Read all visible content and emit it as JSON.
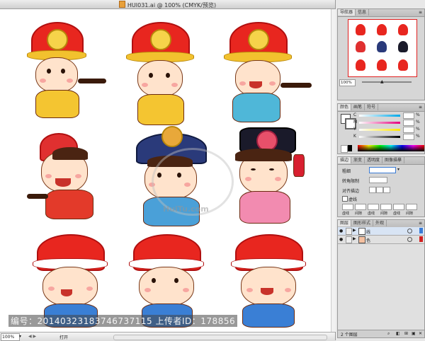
{
  "window": {
    "title": "HUI031.ai @ 100% (CMYK/预览)"
  },
  "watermark": {
    "text": "编号：20140323183746737115 上传者ID：178856",
    "logo_text": "HuiTu.com"
  },
  "statusbar": {
    "zoom": "100%",
    "open_label": "打开",
    "nav_arrows": "◀ ▶"
  },
  "navigator_panel": {
    "tabs": [
      "导航器",
      "信息"
    ],
    "zoom": "100%"
  },
  "color_panel": {
    "tabs": [
      "颜色",
      "画笔",
      "符号"
    ],
    "channels": [
      {
        "label": "C",
        "color": "#00a8e8"
      },
      {
        "label": "M",
        "color": "#e6007e"
      },
      {
        "label": "Y",
        "color": "#ffe600"
      },
      {
        "label": "K",
        "color": "#000000"
      }
    ],
    "unit": "%"
  },
  "stroke_panel": {
    "tabs": [
      "描边",
      "渐变",
      "透明度",
      "图像描摹"
    ],
    "weight_label": "粗细",
    "miter_label": "转角限制",
    "align_label": "对齐描边",
    "dashed_label": "虚线",
    "dash_labels": [
      "虚线",
      "间隙",
      "虚线",
      "间隙",
      "虚线",
      "间隙"
    ]
  },
  "layers_panel": {
    "tabs": [
      "图层",
      "图形样式",
      "外观"
    ],
    "layers": [
      {
        "name": "线",
        "color": "#3a7bd5"
      },
      {
        "name": "色",
        "color": "#d22020"
      }
    ],
    "count_label": "2 个图层"
  },
  "colors": {
    "hat_red": "#e8261f",
    "gold": "#f2c12e",
    "skin": "#ffe3cc",
    "hair": "#4a2412"
  }
}
